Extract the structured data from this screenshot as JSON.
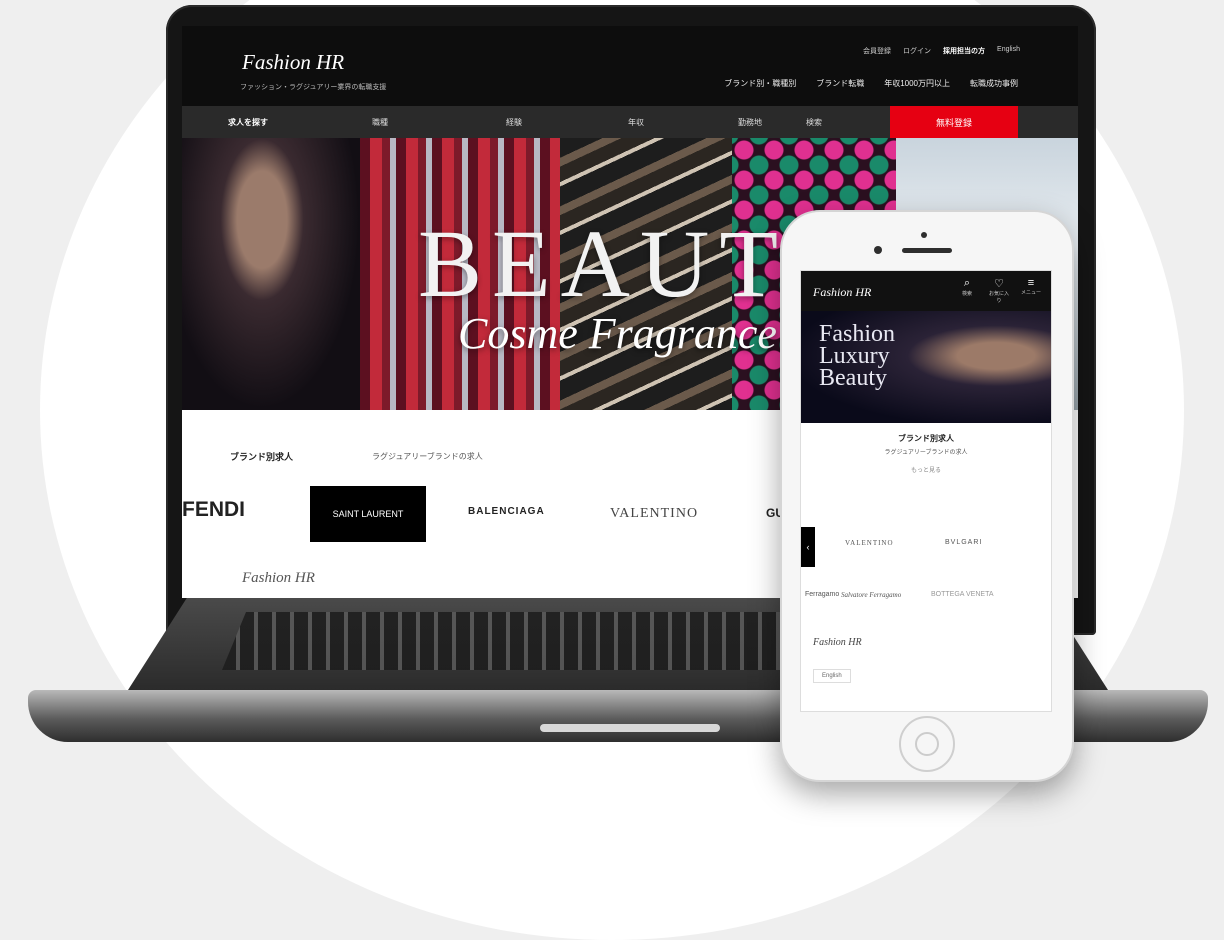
{
  "site": {
    "logo": "Fashion HR",
    "tagline": "ファッション・ラグジュアリー業界の転職支援",
    "util_links": [
      "会員登録",
      "ログイン",
      "採用担当の方",
      "English"
    ],
    "header_nav": [
      "ブランド別・職種別",
      "ブランド転職",
      "年収1000万円以上",
      "転職成功事例"
    ],
    "main_nav": {
      "items": [
        "求人を探す",
        "職種",
        "経験",
        "年収",
        "勤務地",
        "検索"
      ],
      "cta": "無料登録"
    },
    "hero": {
      "title": "BEAUTY",
      "subtitle": "Cosme Fragrance"
    },
    "section": {
      "title": "ブランド別求人",
      "subtitle": "ラグジュアリーブランドの求人"
    },
    "brands": [
      "FENDI",
      "SAINT LAURENT",
      "BALENCIAGA",
      "VALENTINO",
      "GUCCI"
    ],
    "footer_logo": "Fashion HR"
  },
  "mobile": {
    "logo": "Fashion HR",
    "icons": [
      {
        "name": "search-icon",
        "glyph": "⌕",
        "label": "検索"
      },
      {
        "name": "heart-icon",
        "glyph": "♡",
        "label": "お気に入り"
      },
      {
        "name": "menu-icon",
        "glyph": "≡",
        "label": "メニュー"
      }
    ],
    "hero_text": "Fashion Luxury Beauty",
    "section": {
      "title": "ブランド別求人",
      "subtitle": "ラグジュアリーブランドの求人",
      "link": "もっと見る"
    },
    "brands": [
      "VALENTINO",
      "BVLGARI",
      "Ferragamo",
      "Salvatore Ferragamo",
      "BOTTEGA VENETA"
    ],
    "footer_logo": "Fashion HR",
    "language": "English"
  },
  "colors": {
    "accent_red": "#e60012",
    "header_black": "#0d0d0d"
  }
}
